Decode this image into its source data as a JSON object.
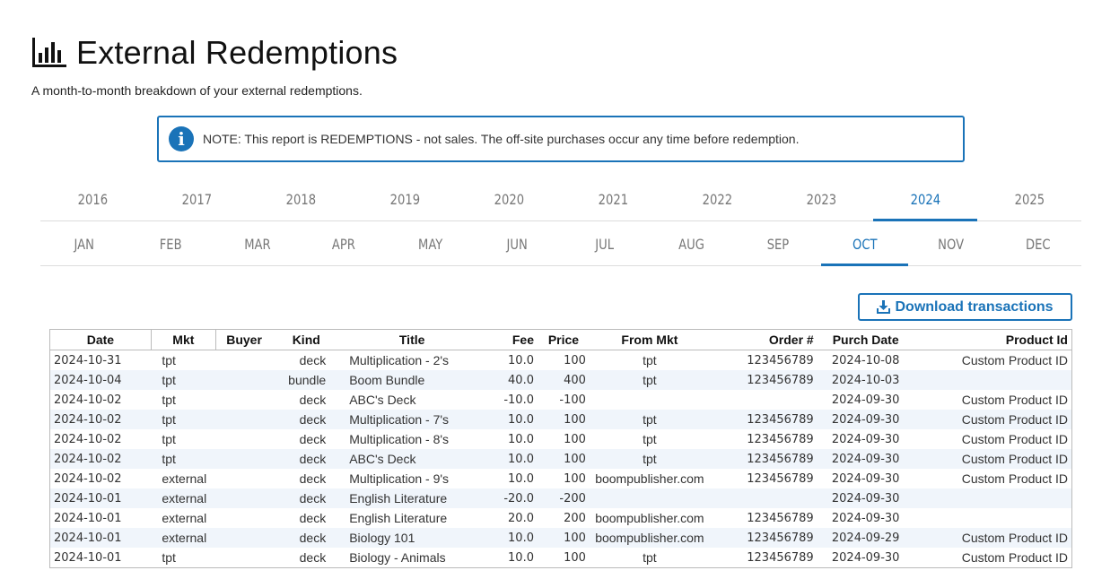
{
  "page": {
    "title": "External Redemptions",
    "subtitle": "A month-to-month breakdown of your external redemptions.",
    "note": "NOTE: This report is REDEMPTIONS - not sales. The off-site purchases occur any time before redemption.",
    "note_icon": "info-icon",
    "accent_color": "#1a73b8"
  },
  "years": [
    "2016",
    "2017",
    "2018",
    "2019",
    "2020",
    "2021",
    "2022",
    "2023",
    "2024",
    "2025"
  ],
  "selected_year": "2024",
  "months": [
    "JAN",
    "FEB",
    "MAR",
    "APR",
    "MAY",
    "JUN",
    "JUL",
    "AUG",
    "SEP",
    "OCT",
    "NOV",
    "DEC"
  ],
  "selected_month": "OCT",
  "download_label": "Download transactions",
  "table": {
    "headers": [
      "Date",
      "Mkt",
      "Buyer",
      "Kind",
      "Title",
      "Fee",
      "Price",
      "From Mkt",
      "Order #",
      "Purch Date",
      "Product Id"
    ],
    "rows": [
      [
        "2024-10-31",
        "tpt",
        "",
        "deck",
        "Multiplication - 2's",
        "10.0",
        "100",
        "tpt",
        "123456789",
        "2024-10-08",
        "Custom Product ID"
      ],
      [
        "2024-10-04",
        "tpt",
        "",
        "bundle",
        "Boom Bundle",
        "40.0",
        "400",
        "tpt",
        "123456789",
        "2024-10-03",
        ""
      ],
      [
        "2024-10-02",
        "tpt",
        "",
        "deck",
        "ABC's Deck",
        "-10.0",
        "-100",
        "",
        "",
        "2024-09-30",
        "Custom Product ID"
      ],
      [
        "2024-10-02",
        "tpt",
        "",
        "deck",
        "Multiplication - 7's",
        "10.0",
        "100",
        "tpt",
        "123456789",
        "2024-09-30",
        "Custom Product ID"
      ],
      [
        "2024-10-02",
        "tpt",
        "",
        "deck",
        "Multiplication - 8's",
        "10.0",
        "100",
        "tpt",
        "123456789",
        "2024-09-30",
        "Custom Product ID"
      ],
      [
        "2024-10-02",
        "tpt",
        "",
        "deck",
        "ABC's Deck",
        "10.0",
        "100",
        "tpt",
        "123456789",
        "2024-09-30",
        "Custom Product ID"
      ],
      [
        "2024-10-02",
        "external",
        "",
        "deck",
        "Multiplication - 9's",
        "10.0",
        "100",
        "boompublisher.com",
        "123456789",
        "2024-09-30",
        "Custom Product ID"
      ],
      [
        "2024-10-01",
        "external",
        "",
        "deck",
        "English Literature",
        "-20.0",
        "-200",
        "",
        "",
        "2024-09-30",
        ""
      ],
      [
        "2024-10-01",
        "external",
        "",
        "deck",
        "English Literature",
        "20.0",
        "200",
        "boompublisher.com",
        "123456789",
        "2024-09-30",
        ""
      ],
      [
        "2024-10-01",
        "external",
        "",
        "deck",
        "Biology 101",
        "10.0",
        "100",
        "boompublisher.com",
        "123456789",
        "2024-09-29",
        "Custom Product ID"
      ],
      [
        "2024-10-01",
        "tpt",
        "",
        "deck",
        "Biology - Animals",
        "10.0",
        "100",
        "tpt",
        "123456789",
        "2024-09-30",
        "Custom Product ID"
      ]
    ]
  }
}
